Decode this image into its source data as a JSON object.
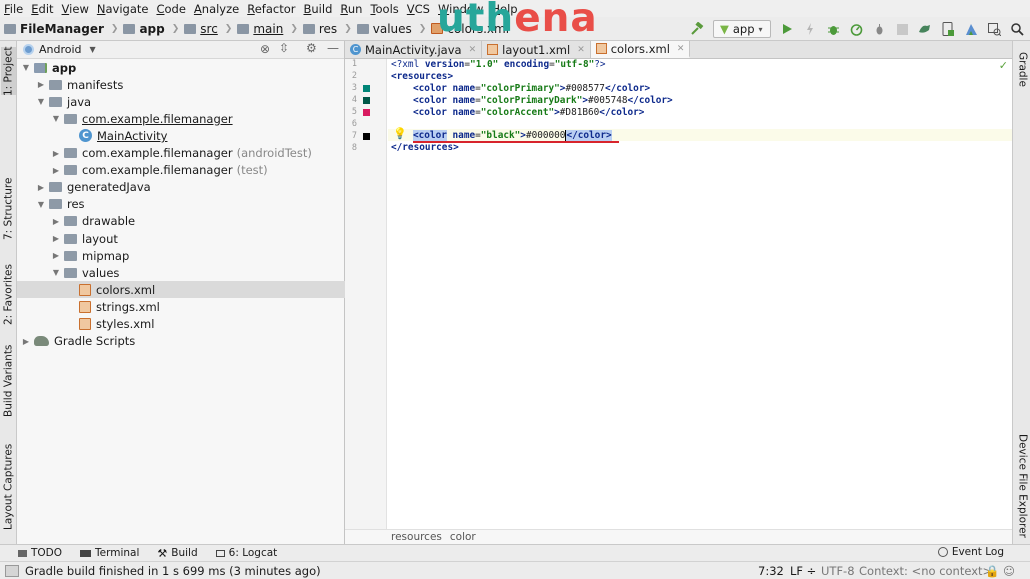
{
  "menu": [
    "File",
    "Edit",
    "View",
    "Navigate",
    "Code",
    "Analyze",
    "Refactor",
    "Build",
    "Run",
    "Tools",
    "VCS",
    "Window",
    "Help"
  ],
  "breadcrumbs": [
    {
      "label": "FileManager",
      "bold": true
    },
    {
      "label": "app",
      "bold": true
    },
    {
      "label": "src",
      "underline": true
    },
    {
      "label": "main",
      "underline": true
    },
    {
      "label": "res"
    },
    {
      "label": "values"
    },
    {
      "label": "colors.xml",
      "xml": true
    }
  ],
  "logo": {
    "part1": "uth",
    "part2": "ena"
  },
  "toolbar": {
    "run_config": "app",
    "icons": [
      "hammer-icon",
      "run-icon",
      "apply-changes-icon",
      "debug-icon",
      "profile-icon",
      "attach-debugger-icon",
      "sync-gradle-icon",
      "avd-manager-icon",
      "sdk-manager-icon",
      "layout-inspector-icon",
      "search-everywhere-icon"
    ]
  },
  "left_tabs": [
    {
      "label": "1: Project",
      "selected": true
    },
    {
      "label": "7: Structure"
    },
    {
      "label": "2: Favorites"
    },
    {
      "label": "Build Variants"
    },
    {
      "label": "Layout Captures"
    }
  ],
  "right_tabs": [
    {
      "label": "Gradle"
    },
    {
      "label": "Device File Explorer"
    }
  ],
  "project": {
    "view_mode": "Android",
    "tree": [
      {
        "label": "app",
        "depth": 0,
        "icon": "mod",
        "arrow": "open",
        "bold": true
      },
      {
        "label": "manifests",
        "depth": 1,
        "icon": "folder",
        "arrow": "closed"
      },
      {
        "label": "java",
        "depth": 1,
        "icon": "folder",
        "arrow": "open"
      },
      {
        "label": "com.example.filemanager",
        "depth": 2,
        "icon": "folder",
        "arrow": "open",
        "underline": true
      },
      {
        "label": "MainActivity",
        "depth": 3,
        "icon": "cls",
        "arrow": "none",
        "underline": true
      },
      {
        "label": "com.example.filemanager",
        "depth": 2,
        "icon": "folder",
        "arrow": "closed",
        "suffix": "(androidTest)"
      },
      {
        "label": "com.example.filemanager",
        "depth": 2,
        "icon": "folder",
        "arrow": "closed",
        "suffix": "(test)"
      },
      {
        "label": "generatedJava",
        "depth": 1,
        "icon": "folder",
        "arrow": "closed"
      },
      {
        "label": "res",
        "depth": 1,
        "icon": "folder",
        "arrow": "open"
      },
      {
        "label": "drawable",
        "depth": 2,
        "icon": "folder",
        "arrow": "closed"
      },
      {
        "label": "layout",
        "depth": 2,
        "icon": "folder",
        "arrow": "closed"
      },
      {
        "label": "mipmap",
        "depth": 2,
        "icon": "folder",
        "arrow": "closed"
      },
      {
        "label": "values",
        "depth": 2,
        "icon": "folder",
        "arrow": "open"
      },
      {
        "label": "colors.xml",
        "depth": 3,
        "icon": "xml",
        "arrow": "none",
        "selected": true
      },
      {
        "label": "strings.xml",
        "depth": 3,
        "icon": "xml",
        "arrow": "none"
      },
      {
        "label": "styles.xml",
        "depth": 3,
        "icon": "xml",
        "arrow": "none"
      },
      {
        "label": "Gradle Scripts",
        "depth": 0,
        "icon": "gradle",
        "arrow": "closed"
      }
    ]
  },
  "editor_tabs": [
    {
      "label": "MainActivity.java",
      "icon": "cls"
    },
    {
      "label": "layout1.xml",
      "icon": "xml"
    },
    {
      "label": "colors.xml",
      "icon": "xml",
      "active": true
    }
  ],
  "code": {
    "line_numbers": [
      "1",
      "2",
      "3",
      "4",
      "5",
      "6",
      "7",
      "8"
    ],
    "swatches": [
      "#008577",
      "#005748",
      "#D81B60",
      "",
      "#000000"
    ],
    "line1": {
      "a": "<?xml ",
      "b": "version",
      "c": "=",
      "d": "\"1.0\"",
      "e": " ",
      "f": "encoding",
      "g": "=",
      "h": "\"utf-8\"",
      "i": "?>"
    },
    "line2": "<resources>",
    "colors": [
      {
        "open": "<color ",
        "attr": "name",
        "eq": "=",
        "val": "\"colorPrimary\"",
        "gt": ">",
        "text": "#008577",
        "close": "</color>"
      },
      {
        "open": "<color ",
        "attr": "name",
        "eq": "=",
        "val": "\"colorPrimaryDark\"",
        "gt": ">",
        "text": "#005748",
        "close": "</color>"
      },
      {
        "open": "<color ",
        "attr": "name",
        "eq": "=",
        "val": "\"colorAccent\"",
        "gt": ">",
        "text": "#D81B60",
        "close": "</color>"
      }
    ],
    "line7": {
      "open": "<color",
      "sp": " ",
      "attr": "name",
      "eq": "=",
      "val": "\"black\"",
      "gt": ">",
      "text": "#000000",
      "close": "</color>"
    },
    "line8": "</resources>"
  },
  "editor_breadcrumb": [
    "resources",
    "color"
  ],
  "tool_windows": [
    {
      "label": "TODO",
      "icon": "todo-icon"
    },
    {
      "label": "Terminal",
      "icon": "terminal-icon"
    },
    {
      "label": "Build",
      "icon": "build-icon"
    },
    {
      "label": "6: Logcat",
      "icon": "logcat-icon"
    }
  ],
  "event_log": "Event Log",
  "status": {
    "message": "Gradle build finished in 1 s 699 ms (3 minutes ago)",
    "position": "7:32",
    "line_sep": "LF ÷",
    "encoding": "UTF-8",
    "context": "Context: <no context>"
  }
}
